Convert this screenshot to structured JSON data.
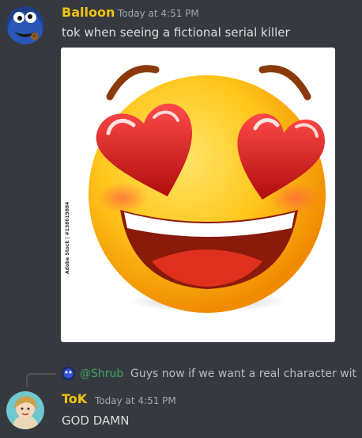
{
  "messages": [
    {
      "username": "Balloon",
      "timestamp": "Today at 4:51 PM",
      "text": "tok when seeing a fictional serial killer",
      "attachment": {
        "watermark": "Adobe Stock | #138019884"
      }
    },
    {
      "reply": {
        "mention": "@Shrub",
        "text": "Guys now if we want a real character wit"
      },
      "username": "ToK",
      "timestamp": "Today at 4:51 PM",
      "text": "GOD DAMN"
    }
  ],
  "colors": {
    "background": "#36393f",
    "username_balloon": "#f1c40f",
    "username_tok": "#f1c40f",
    "mention": "#3ba55d"
  }
}
